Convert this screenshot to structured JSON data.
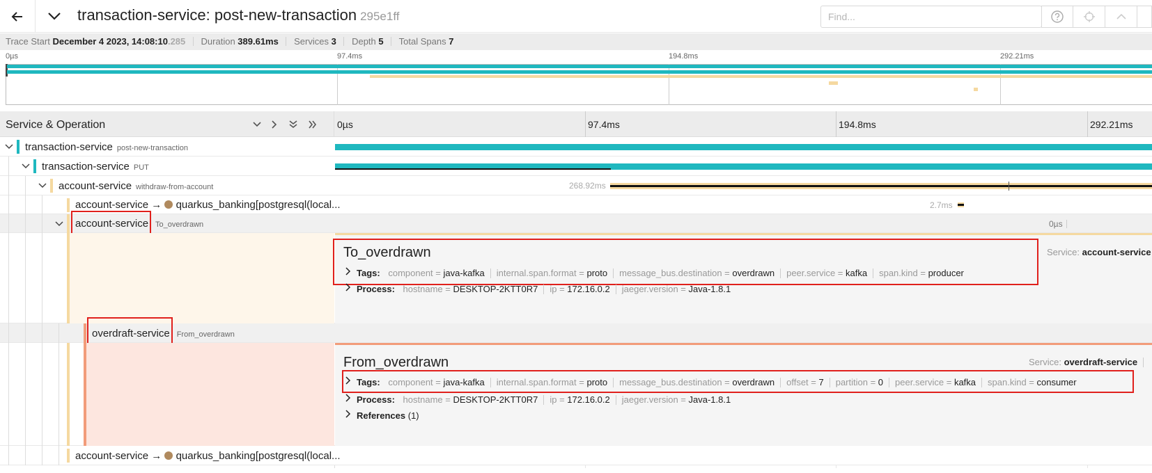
{
  "header": {
    "title": "transaction-service: post-new-transaction",
    "trace_id": "295e1ff",
    "find_placeholder": "Find..."
  },
  "summary": {
    "trace_start_label": "Trace Start",
    "trace_start_value": "December 4 2023, 14:08:10",
    "trace_start_ms": ".285",
    "duration_label": "Duration",
    "duration_value": "389.61ms",
    "services_label": "Services",
    "services_value": "3",
    "depth_label": "Depth",
    "depth_value": "5",
    "total_spans_label": "Total Spans",
    "total_spans_value": "7"
  },
  "minimap": {
    "ticks": [
      "0µs",
      "97.4ms",
      "194.8ms",
      "292.21ms"
    ]
  },
  "column_header": {
    "title": "Service & Operation",
    "ticks": [
      "0µs",
      "97.4ms",
      "194.8ms",
      "292.21ms"
    ]
  },
  "colors": {
    "transaction_service": "#1fb8bf",
    "account_service": "#f5d9a0",
    "overdraft_service": "#f29c7a",
    "db_dot": "#b08a5e",
    "highlight_box": "#e0201c"
  },
  "rows": [
    {
      "service": "transaction-service",
      "operation": "post-new-transaction"
    },
    {
      "service": "transaction-service",
      "operation": "PUT"
    },
    {
      "service": "account-service",
      "operation": "withdraw-from-account",
      "duration": "268.92ms"
    },
    {
      "service": "account-service",
      "arrow": "→",
      "target": "quarkus_banking[postgresql(local...",
      "duration": "2.7ms"
    },
    {
      "service": "account-service",
      "operation": "To_overdrawn",
      "duration": "0µs"
    },
    {
      "service": "overdraft-service",
      "operation": "From_overdrawn"
    },
    {
      "service": "account-service",
      "arrow": "→",
      "target": "quarkus_banking[postgresql(local..."
    }
  ],
  "detail_to": {
    "title": "To_overdrawn",
    "service_label": "Service:",
    "service_value": "account-service",
    "tags_label": "Tags:",
    "tags": [
      {
        "k": "component",
        "v": "java-kafka"
      },
      {
        "k": "internal.span.format",
        "v": "proto"
      },
      {
        "k": "message_bus.destination",
        "v": "overdrawn"
      },
      {
        "k": "peer.service",
        "v": "kafka"
      },
      {
        "k": "span.kind",
        "v": "producer"
      }
    ],
    "process_label": "Process:",
    "process": [
      {
        "k": "hostname",
        "v": "DESKTOP-2KTT0R7"
      },
      {
        "k": "ip",
        "v": "172.16.0.2"
      },
      {
        "k": "jaeger.version",
        "v": "Java-1.8.1"
      }
    ]
  },
  "detail_from": {
    "title": "From_overdrawn",
    "service_label": "Service:",
    "service_value": "overdraft-service",
    "tags_label": "Tags:",
    "tags": [
      {
        "k": "component",
        "v": "java-kafka"
      },
      {
        "k": "internal.span.format",
        "v": "proto"
      },
      {
        "k": "message_bus.destination",
        "v": "overdrawn"
      },
      {
        "k": "offset",
        "v": "7"
      },
      {
        "k": "partition",
        "v": "0"
      },
      {
        "k": "peer.service",
        "v": "kafka"
      },
      {
        "k": "span.kind",
        "v": "consumer"
      }
    ],
    "process_label": "Process:",
    "process": [
      {
        "k": "hostname",
        "v": "DESKTOP-2KTT0R7"
      },
      {
        "k": "ip",
        "v": "172.16.0.2"
      },
      {
        "k": "jaeger.version",
        "v": "Java-1.8.1"
      }
    ],
    "references_label": "References",
    "references_count": "(1)"
  }
}
